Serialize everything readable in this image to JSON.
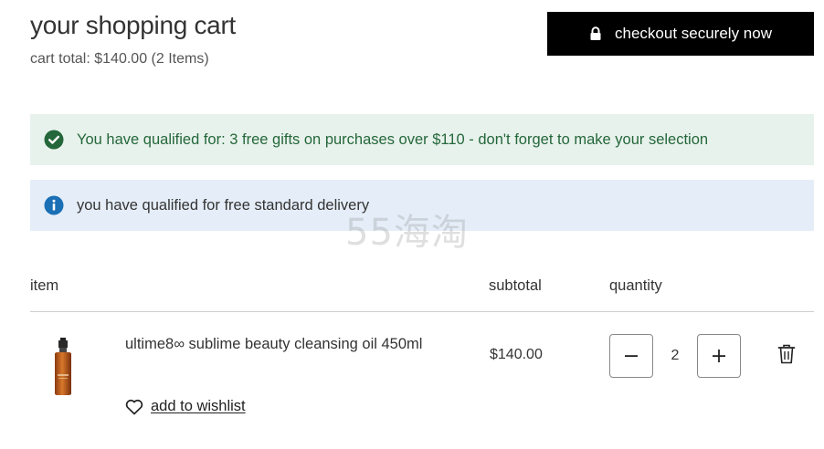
{
  "header": {
    "title": "your shopping cart",
    "cart_total": "cart total: $140.00 (2 Items)"
  },
  "checkout": {
    "label": "checkout securely now",
    "icon": "lock-icon"
  },
  "banners": {
    "success": {
      "text": "You have qualified for: 3 free gifts on purchases over $110 - don't forget to make your selection",
      "icon": "check-circle-icon",
      "color": "#24673b"
    },
    "info": {
      "text": "you have qualified for free standard delivery",
      "icon": "info-circle-icon",
      "color": "#1a6fb5"
    }
  },
  "watermark": "55海淘",
  "table": {
    "headers": {
      "item": "item",
      "subtotal": "subtotal",
      "quantity": "quantity"
    },
    "rows": [
      {
        "name": "ultime8∞ sublime beauty cleansing oil 450ml",
        "subtotal": "$140.00",
        "quantity": "2",
        "wishlist_label": "add to wishlist"
      }
    ]
  },
  "colors": {
    "checkout_bg": "#000000",
    "success_bg": "#e8f2ec",
    "info_bg": "#e5eef8"
  }
}
